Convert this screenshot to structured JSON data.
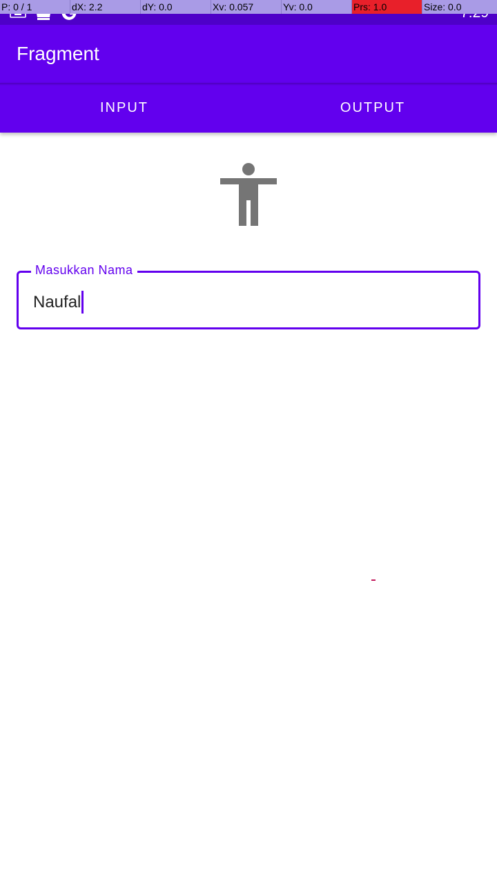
{
  "status_bar": {
    "time": "7:29",
    "icons": [
      "keyboard-icon",
      "crown-icon",
      "google-icon"
    ]
  },
  "debug_overlay": {
    "cells": [
      "P: 0 / 1",
      "dX: 2.2",
      "dY: 0.0",
      "Xv: 0.057",
      "Yv: 0.0",
      "Prs: 1.0",
      "Size: 0.0"
    ]
  },
  "app_bar": {
    "title": "Fragment"
  },
  "tabs": [
    {
      "label": "INPUT"
    },
    {
      "label": "OUTPUT"
    }
  ],
  "form": {
    "icon": "accessibility-icon",
    "name_field": {
      "label": "Masukkan Nama",
      "value": "Naufal"
    }
  },
  "colors": {
    "primary": "#6200ee",
    "status_bar": "#4e00c8",
    "icon_gray": "#757575"
  }
}
